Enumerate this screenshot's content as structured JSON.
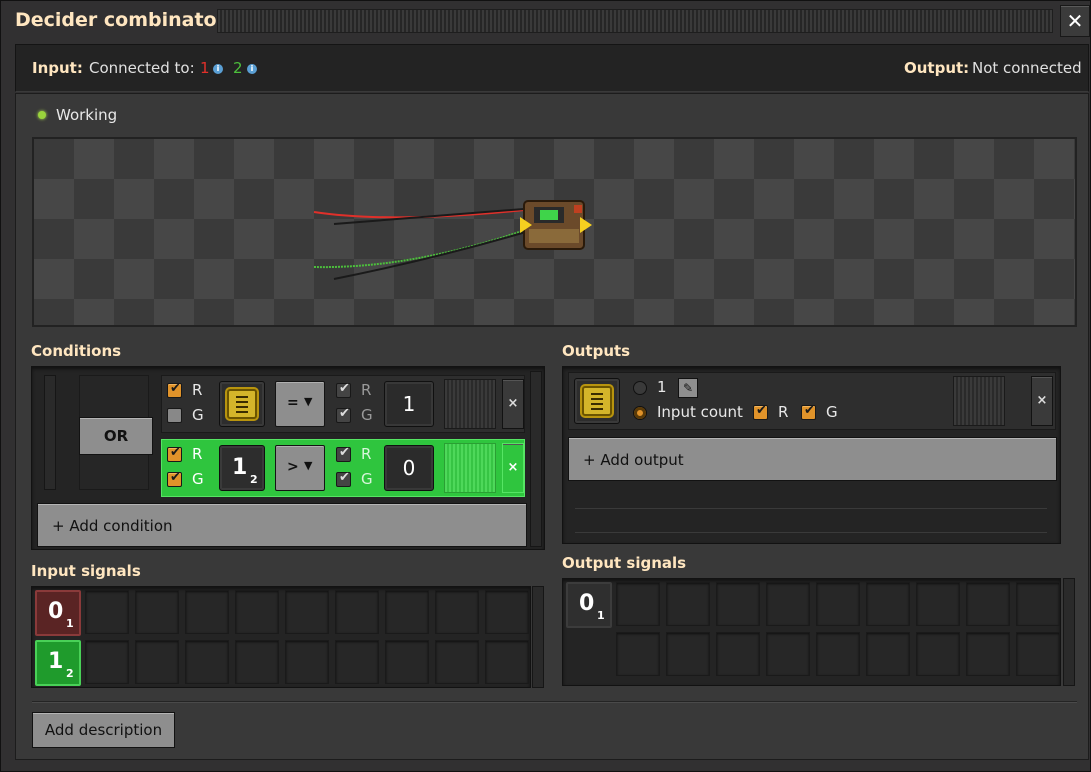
{
  "window": {
    "title": "Decider combinator",
    "close_label": "✕"
  },
  "connection": {
    "input_label": "Input:",
    "connected_to": "Connected to:",
    "wire_red": "1",
    "wire_green": "2",
    "output_label": "Output:",
    "output_status": "Not connected"
  },
  "status": {
    "text": "Working",
    "color": "#9ad43c"
  },
  "conditions": {
    "title": "Conditions",
    "or_label": "OR",
    "rows": [
      {
        "left_r": "R",
        "left_g": "G",
        "left_r_checked": true,
        "left_g_checked": false,
        "signal": "each-signal-icon",
        "operator": "=",
        "right_r": "R",
        "right_g": "G",
        "right_r_checked": true,
        "right_g_checked": true,
        "value": "1",
        "active": false
      },
      {
        "left_r": "R",
        "left_g": "G",
        "left_r_checked": true,
        "left_g_checked": true,
        "signal_main": "1",
        "signal_sub": "2",
        "operator": ">",
        "right_r": "R",
        "right_g": "G",
        "right_r_checked": true,
        "right_g_checked": true,
        "value": "0",
        "active": true
      }
    ],
    "add_label": "+ Add condition",
    "remove_label": "×"
  },
  "outputs": {
    "title": "Outputs",
    "constant_value": "1",
    "input_count_label": "Input count",
    "r_label": "R",
    "g_label": "G",
    "add_label": "+ Add output",
    "remove_label": "×"
  },
  "input_signals": {
    "title": "Input signals",
    "items": [
      {
        "main": "0",
        "sub": "1",
        "color": "red"
      },
      {
        "main": "1",
        "sub": "2",
        "color": "green"
      }
    ]
  },
  "output_signals": {
    "title": "Output signals",
    "items": [
      {
        "main": "0",
        "sub": "1"
      }
    ]
  },
  "footer": {
    "description_label": "Add description"
  },
  "colors": {
    "title": "#ffe6c0",
    "red_wire": "#e0302a",
    "green_wire": "#4cbf3c",
    "active_row": "#2fc53e",
    "checkbox": "#e0932a"
  }
}
